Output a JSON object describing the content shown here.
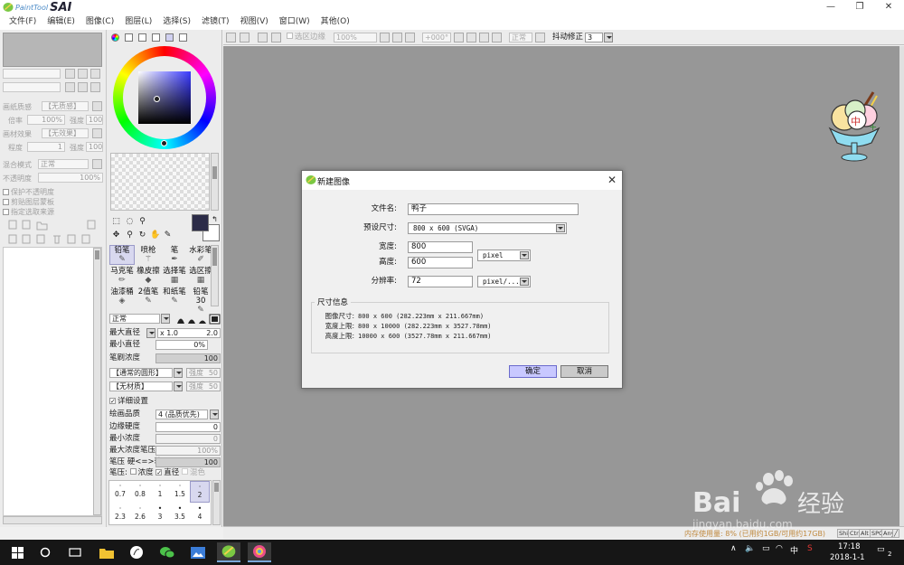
{
  "app": {
    "logo_small": "PaintTool",
    "logo_big": "SAI"
  },
  "menu": [
    {
      "label": "文件(F)"
    },
    {
      "label": "编辑(E)"
    },
    {
      "label": "图像(C)"
    },
    {
      "label": "图层(L)"
    },
    {
      "label": "选择(S)"
    },
    {
      "label": "滤镜(T)"
    },
    {
      "label": "视图(V)"
    },
    {
      "label": "窗口(W)"
    },
    {
      "label": "其他(O)"
    }
  ],
  "left_panel": {
    "paper_texture_label": "画纸质感",
    "paper_texture_value": "【无质感】",
    "scale_label": "倍率",
    "scale_value": "100%",
    "strength_label": "强度",
    "strength_value": "100",
    "effect_label": "画材效果",
    "effect_value": "【无效果】",
    "degree_label": "程度",
    "degree_value": "1",
    "strength2_value": "100",
    "blend_mode_label": "混合模式",
    "blend_mode_value": "正常",
    "opacity_label": "不透明度",
    "opacity_value": "100%",
    "protect_opacity": "保护不透明度",
    "clip_group": "剪贴图层蒙板",
    "select_source": "指定选取来源"
  },
  "tool_panel": {
    "brushes_row1": [
      "铅笔",
      "喷枪",
      "笔",
      "水彩笔"
    ],
    "brushes_row2": [
      "马克笔",
      "橡皮擦",
      "选择笔",
      "选区擦"
    ],
    "brushes_row3": [
      "油漆桶",
      "2值笔",
      "和纸笔",
      "铅笔30"
    ],
    "blend_value": "正常",
    "max_diameter_label": "最大直径",
    "max_diameter_mult": "x 1.0",
    "max_diameter_value": "2.0",
    "min_diameter_label": "最小直径",
    "min_diameter_value": "0%",
    "density_label": "笔刷浓度",
    "density_value": "100",
    "shape_value": "【通常的圆形】",
    "shape_strength_label": "强度",
    "shape_strength_value": "50",
    "texture_value": "【无材质】",
    "texture_strength_label": "强度",
    "texture_strength_value": "50",
    "detail_settings_label": "详细设置",
    "quality_label": "绘画品质",
    "quality_value": "4 (品质优先)",
    "edge_hardness_label": "边缘硬度",
    "edge_hardness_value": "0",
    "min_density_label": "最小浓度",
    "min_density_value": "0",
    "max_pressure_label": "最大浓度笔压",
    "max_pressure_value": "100%",
    "pressure_label": "笔压 硬<=>软",
    "pressure_value": "100",
    "pressure2_label": "笔压:",
    "pressure_density": "浓度",
    "pressure_diameter": "直径",
    "pressure_blend": "混色",
    "size_row1": [
      "0.7",
      "0.8",
      "1",
      "1.5",
      "2"
    ],
    "size_row2": [
      "2.3",
      "2.6",
      "3",
      "3.5",
      "4"
    ]
  },
  "toolbar": {
    "selection_edge": "选区边缘",
    "zoom": "100%",
    "angle": "+000°",
    "blend": "正常",
    "stabilizer_label": "抖动修正",
    "stabilizer_value": "3"
  },
  "status": {
    "memory_text": "内存使用量: 8% (已用约1GB/可用约17GB)",
    "buttons": [
      "Shift",
      "Ctrl",
      "Alt",
      "SPC",
      "Any"
    ]
  },
  "dialog": {
    "title": "新建图像",
    "filename_label": "文件名:",
    "filename_value": "鸭子",
    "preset_label": "预设尺寸:",
    "preset_value": "800 x  600 (SVGA)",
    "width_label": "宽度:",
    "width_value": "800",
    "height_label": "高度:",
    "height_value": "600",
    "resolution_label": "分辨率:",
    "resolution_value": "72",
    "unit_value": "pixel",
    "res_unit_value": "pixel/...",
    "info_title": "尺寸信息",
    "info_rows": [
      {
        "k": "图像尺寸:",
        "v": "800 x 600 (282.223mm x 211.667mm)"
      },
      {
        "k": "宽度上限:",
        "v": "800 x 10000 (282.223mm x 3527.78mm)"
      },
      {
        "k": "高度上限:",
        "v": "10000 x 600 (3527.78mm x 211.667mm)"
      }
    ],
    "ok_label": "确定",
    "cancel_label": "取消"
  },
  "taskbar": {
    "ime": "中",
    "time": "17:18",
    "date": "2018-1-1",
    "notification_count": "2"
  },
  "watermark": {
    "brand": "Bai",
    "suffix": "经验",
    "url": "jingyan.baidu.com"
  },
  "mascot_label": "中",
  "colors": {
    "canvas_bg": "#979797",
    "ok_button": "#c8c8ff",
    "main_color": "#2c2c48",
    "taskbar": "#161616"
  }
}
